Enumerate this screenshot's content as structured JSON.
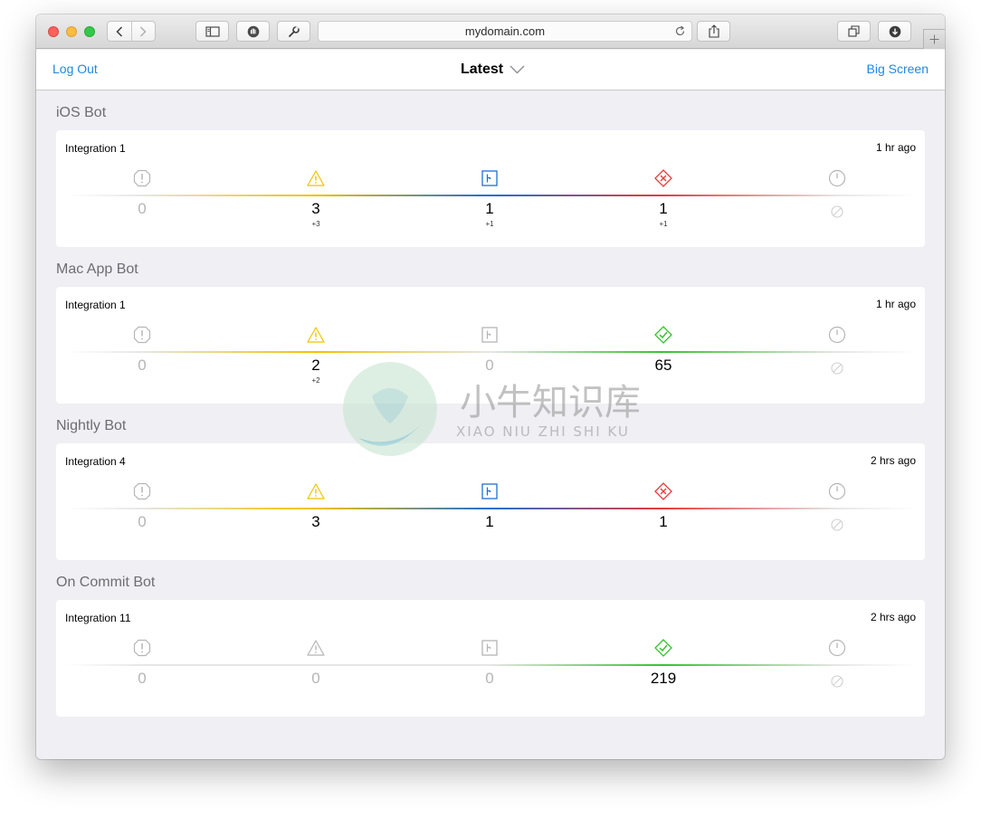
{
  "browser": {
    "url": "mydomain.com"
  },
  "app": {
    "logout_label": "Log Out",
    "title": "Latest",
    "big_screen_label": "Big Screen"
  },
  "bots": [
    {
      "name": "iOS Bot",
      "integration": "Integration 1",
      "time": "1 hr ago",
      "metrics": [
        {
          "type": "errors",
          "value": "0",
          "delta": "",
          "active": false
        },
        {
          "type": "warnings",
          "value": "3",
          "delta": "+3",
          "active": true
        },
        {
          "type": "analysis",
          "value": "1",
          "delta": "+1",
          "active": true
        },
        {
          "type": "tests",
          "status": "failed",
          "value": "1",
          "delta": "+1",
          "active": true
        },
        {
          "type": "duration",
          "value": "",
          "delta": "",
          "active": false
        }
      ]
    },
    {
      "name": "Mac App Bot",
      "integration": "Integration 1",
      "time": "1 hr ago",
      "metrics": [
        {
          "type": "errors",
          "value": "0",
          "delta": "",
          "active": false
        },
        {
          "type": "warnings",
          "value": "2",
          "delta": "+2",
          "active": true
        },
        {
          "type": "analysis",
          "value": "0",
          "delta": "",
          "active": false
        },
        {
          "type": "tests",
          "status": "passed",
          "value": "65",
          "delta": "",
          "active": true
        },
        {
          "type": "duration",
          "value": "",
          "delta": "",
          "active": false
        }
      ]
    },
    {
      "name": "Nightly Bot",
      "integration": "Integration 4",
      "time": "2 hrs ago",
      "metrics": [
        {
          "type": "errors",
          "value": "0",
          "delta": "",
          "active": false
        },
        {
          "type": "warnings",
          "value": "3",
          "delta": "",
          "active": true
        },
        {
          "type": "analysis",
          "value": "1",
          "delta": "",
          "active": true
        },
        {
          "type": "tests",
          "status": "failed",
          "value": "1",
          "delta": "",
          "active": true
        },
        {
          "type": "duration",
          "value": "",
          "delta": "",
          "active": false
        }
      ]
    },
    {
      "name": "On Commit Bot",
      "integration": "Integration 11",
      "time": "2 hrs ago",
      "metrics": [
        {
          "type": "errors",
          "value": "0",
          "delta": "",
          "active": false
        },
        {
          "type": "warnings",
          "value": "0",
          "delta": "",
          "active": false
        },
        {
          "type": "analysis",
          "value": "0",
          "delta": "",
          "active": false
        },
        {
          "type": "tests",
          "status": "passed",
          "value": "219",
          "delta": "",
          "active": true
        },
        {
          "type": "duration",
          "value": "",
          "delta": "",
          "active": false
        }
      ]
    }
  ],
  "colors": {
    "accent": "#1e88e5",
    "warning": "#f2c200",
    "analysis": "#1f6fd6",
    "failed": "#e83b3b",
    "passed": "#39c230",
    "inactive": "#b5b5b5"
  },
  "watermark": {
    "cn": "小牛知识库",
    "en": "XIAO NIU ZHI SHI KU"
  }
}
